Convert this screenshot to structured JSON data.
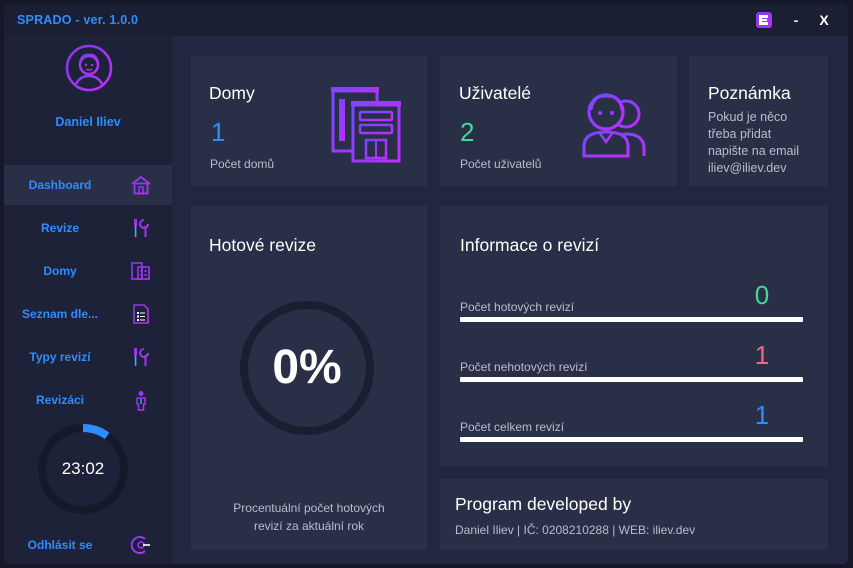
{
  "window": {
    "title": "SPRADO - ver. 1.0.0",
    "minimize_label": "-",
    "close_label": "X"
  },
  "colors": {
    "accent": "#2f8cff",
    "green": "#3ddc97",
    "red": "#f06a7a",
    "blue": "#2f8cff",
    "icon_gradient_start": "#7b3fe4",
    "icon_gradient_end": "#c02cff"
  },
  "sidebar": {
    "user_name": "Daniel Iliev",
    "avatar_icon": "user-avatar-icon",
    "items": [
      {
        "label": "Dashboard",
        "icon": "house-icon",
        "active": true
      },
      {
        "label": "Revize",
        "icon": "tools-icon"
      },
      {
        "label": "Domy",
        "icon": "building-icon"
      },
      {
        "label": "Seznam dle...",
        "icon": "document-list-icon"
      },
      {
        "label": "Typy revizí",
        "icon": "tools-icon"
      },
      {
        "label": "Revizáci",
        "icon": "person-icon"
      }
    ],
    "timer": "23:02",
    "timer_progress": 0.1,
    "logout_label": "Odhlásit se",
    "logout_icon": "logout-icon"
  },
  "cards": {
    "houses": {
      "title": "Domy",
      "value": "1",
      "caption": "Počet domů",
      "icon": "buildings-icon"
    },
    "users": {
      "title": "Uživatelé",
      "value": "2",
      "caption": "Počet uživatelů",
      "icon": "users-icon"
    },
    "note": {
      "title": "Poznámka",
      "text_lines": [
        "Pokud je něco",
        "třeba přidat",
        "napište na email",
        "iliev@iliev.dev"
      ]
    },
    "done_revisions": {
      "title": "Hotové revize",
      "percent": "0%",
      "caption_lines": [
        "Procentuální počet hotových",
        "revizí za aktuální rok"
      ]
    },
    "revision_info": {
      "title": "Informace o revizí",
      "rows": [
        {
          "label": "Počet hotových revizí",
          "value": "0"
        },
        {
          "label": "Počet nehotových revizí",
          "value": "1"
        },
        {
          "label": "Počet celkem revizí",
          "value": "1"
        }
      ]
    },
    "developer": {
      "title": "Program developed by",
      "text": "Daniel Iliev | IČ: 0208210288 | WEB: iliev.dev"
    }
  }
}
